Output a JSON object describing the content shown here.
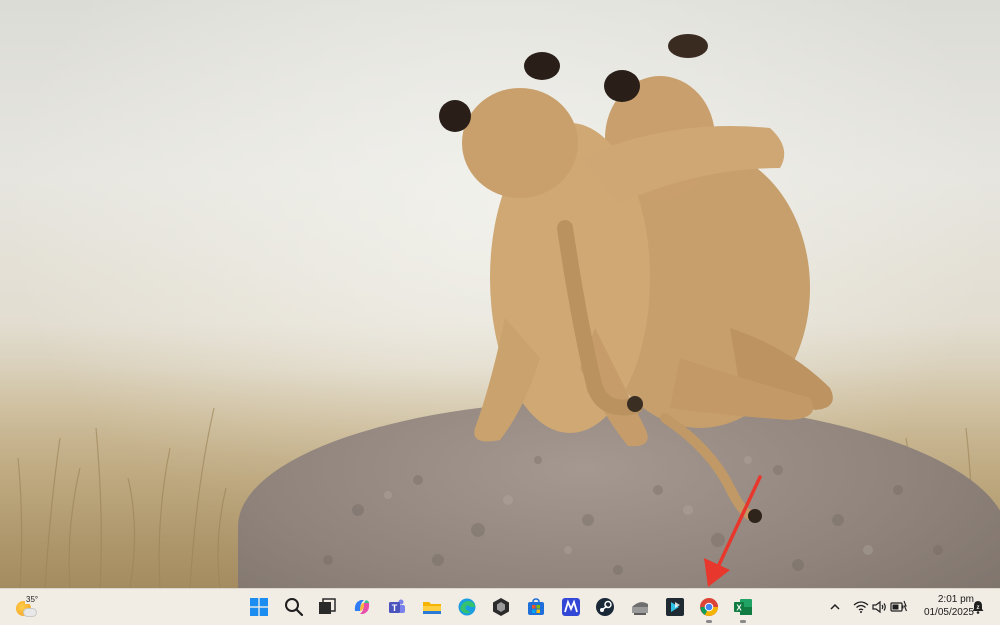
{
  "taskbar": {
    "weather": {
      "temperature": "35°"
    },
    "apps": [
      {
        "name": "Start",
        "icon": "windows-start-icon",
        "running": false
      },
      {
        "name": "Search",
        "icon": "search-icon",
        "running": false
      },
      {
        "name": "Task View",
        "icon": "task-view-icon",
        "running": false
      },
      {
        "name": "Copilot",
        "icon": "copilot-icon",
        "running": false
      },
      {
        "name": "Microsoft Teams",
        "icon": "teams-icon",
        "running": false
      },
      {
        "name": "File Explorer",
        "icon": "file-explorer-icon",
        "running": false
      },
      {
        "name": "Microsoft Edge",
        "icon": "edge-icon",
        "running": false
      },
      {
        "name": "App",
        "icon": "hexagon-app-icon",
        "running": false
      },
      {
        "name": "Microsoft Store",
        "icon": "store-icon",
        "running": false
      },
      {
        "name": "App",
        "icon": "m-app-icon",
        "running": false
      },
      {
        "name": "Steam",
        "icon": "steam-icon",
        "running": false
      },
      {
        "name": "App",
        "icon": "printer-app-icon",
        "running": false
      },
      {
        "name": "App",
        "icon": "kodi-like-app-icon",
        "running": false
      },
      {
        "name": "Google Chrome",
        "icon": "chrome-icon",
        "running": true
      },
      {
        "name": "Microsoft Excel",
        "icon": "excel-icon",
        "running": true
      }
    ],
    "tray": {
      "icons": [
        "chevron-up-icon",
        "wifi-icon",
        "volume-icon",
        "battery-icon"
      ],
      "time": "2:01 pm",
      "date": "01/05/2025",
      "notification_icon": "notification-bell-icon"
    }
  },
  "colors": {
    "taskbar_bg": "#f1ece4",
    "arrow": "#e8372c",
    "chrome_red": "#db4437",
    "chrome_yellow": "#f4b400",
    "chrome_green": "#0f9d58",
    "chrome_blue": "#4285f4",
    "excel_green": "#107c41"
  }
}
